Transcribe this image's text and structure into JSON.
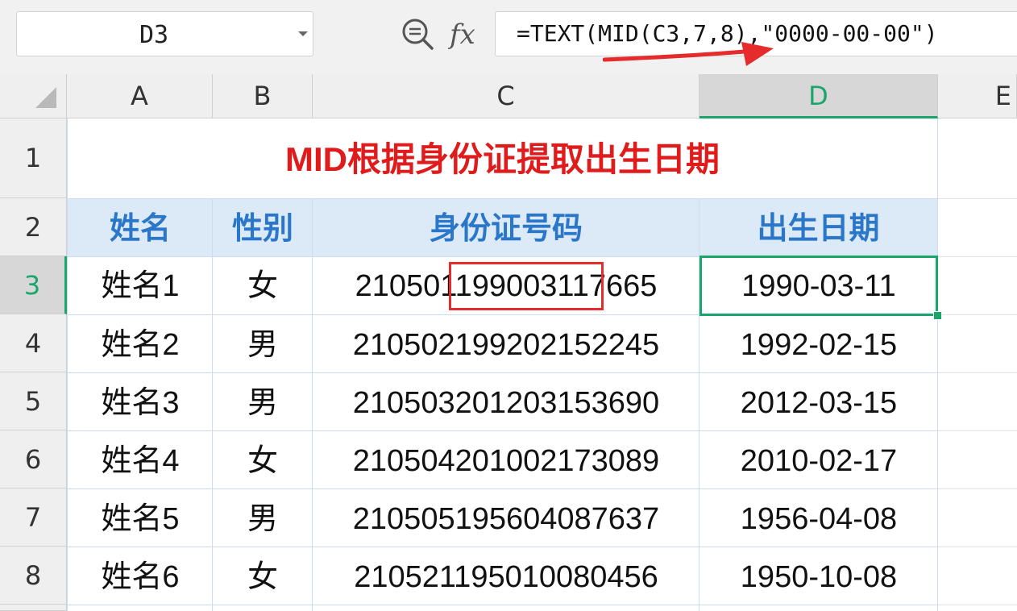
{
  "formula_bar": {
    "name_box": "D3",
    "formula": "=TEXT(MID(C3,7,8),\"0000-00-00\")",
    "fx_label": "fx",
    "zoom_icon": "zoom-formula-icon",
    "arrow_color": "#e52b2b"
  },
  "columns": [
    "A",
    "B",
    "C",
    "D",
    "E"
  ],
  "rows": [
    "1",
    "2",
    "3",
    "4",
    "5",
    "6",
    "7",
    "8"
  ],
  "title": "MID根据身份证提取出生日期",
  "headers": [
    "姓名",
    "性别",
    "身份证号码",
    "出生日期"
  ],
  "records": [
    {
      "name": "姓名1",
      "gender": "女",
      "id": "210501199003117665",
      "birth": "1990-03-11"
    },
    {
      "name": "姓名2",
      "gender": "男",
      "id": "210502199202152245",
      "birth": "1992-02-15"
    },
    {
      "name": "姓名3",
      "gender": "男",
      "id": "210503201203153690",
      "birth": "2012-03-15"
    },
    {
      "name": "姓名4",
      "gender": "女",
      "id": "210504201002173089",
      "birth": "2010-02-17"
    },
    {
      "name": "姓名5",
      "gender": "男",
      "id": "210505195604087637",
      "birth": "1956-04-08"
    },
    {
      "name": "姓名6",
      "gender": "女",
      "id": "210521195010080456",
      "birth": "1950-10-08"
    }
  ],
  "selected_cell": "D3",
  "colors": {
    "title": "#e01b1b",
    "header_text": "#2a77c9",
    "header_fill": "#dce9f7",
    "selection": "#1aa56b",
    "highlight": "#e52b2b"
  }
}
